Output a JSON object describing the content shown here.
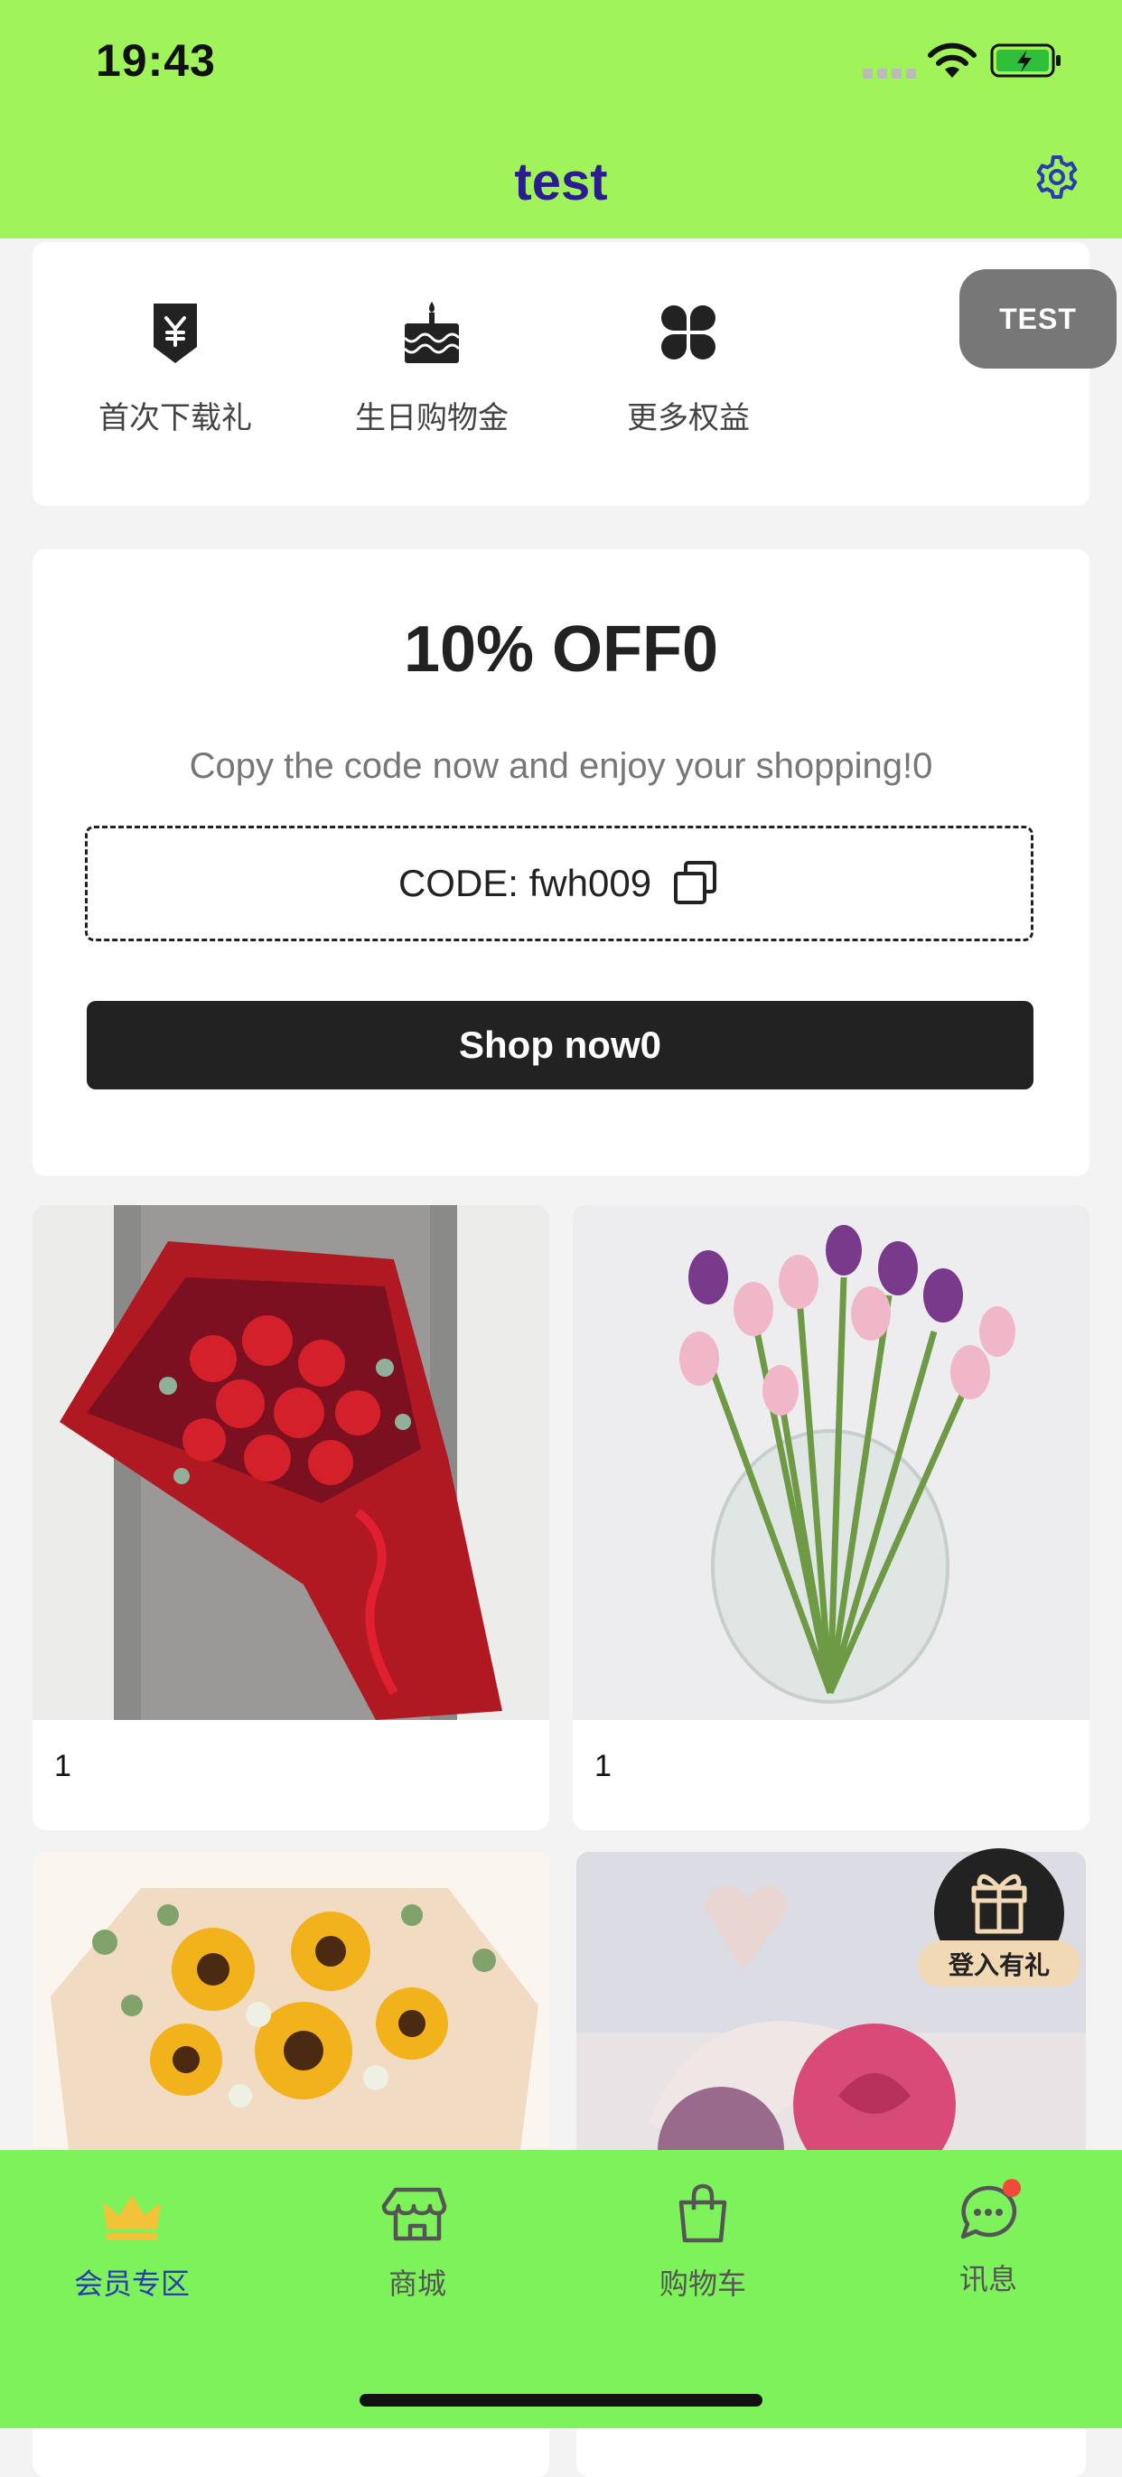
{
  "status_bar": {
    "time": "19:43"
  },
  "nav": {
    "title": "test"
  },
  "benefits": [
    {
      "label": "首次下载礼",
      "icon": "yen-tag-icon"
    },
    {
      "label": "生日购物金",
      "icon": "birthday-cake-icon"
    },
    {
      "label": "更多权益",
      "icon": "clover-grid-icon"
    }
  ],
  "test_button": {
    "label": "TEST"
  },
  "coupon": {
    "title": "10% OFF0",
    "subtitle": "Copy the code now and enjoy your shopping!0",
    "code_text": "CODE: fwh009",
    "button": "Shop now0"
  },
  "products": [
    {
      "label": "1",
      "image": "red rose bouquet"
    },
    {
      "label": "1",
      "image": "tulips in glass vase"
    },
    {
      "label": "",
      "image": "sunflower bouquet"
    },
    {
      "label": "",
      "image": "pink rose arrangement"
    }
  ],
  "gift_float": {
    "label": "登入有礼"
  },
  "tabs": [
    {
      "label": "会员专区",
      "icon": "crown-icon",
      "active": true
    },
    {
      "label": "商城",
      "icon": "store-icon",
      "active": false
    },
    {
      "label": "购物车",
      "icon": "shopping-bag-icon",
      "active": false
    },
    {
      "label": "讯息",
      "icon": "chat-icon",
      "active": false,
      "badge": true
    }
  ],
  "colors": {
    "header_green": "#a1f35a",
    "tabbar_green": "#7df25a",
    "title_blue": "#2a1d8f",
    "active_tab": "#2a3db0"
  }
}
